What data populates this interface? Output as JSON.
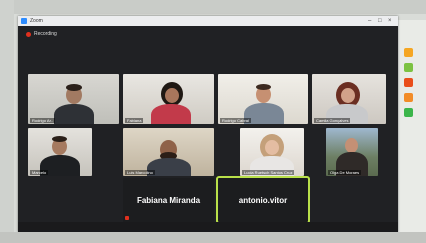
{
  "window": {
    "app_name": "Zoom",
    "recording_label": "Recording"
  },
  "participants": [
    {
      "name": "Rodrigo Ar.."
    },
    {
      "name": "Fabiana"
    },
    {
      "name": "Rodrigo Cabral"
    },
    {
      "name": "Camila Gonçalves"
    },
    {
      "name": "Marcelo"
    },
    {
      "name": "Luis Marcolino"
    },
    {
      "name": "Lucia Ruetsch Santos Cruz"
    },
    {
      "name": "Olga De Moraes"
    },
    {
      "name": "Fabiana Miranda"
    },
    {
      "name": "antonio.vitor"
    }
  ],
  "colors": {
    "active_speaker": "#b9e04a",
    "recording_dot": "#e0301e",
    "side_icons": [
      "#f5a623",
      "#7cc242",
      "#e94e1b",
      "#f28c28",
      "#3bb54a"
    ]
  }
}
